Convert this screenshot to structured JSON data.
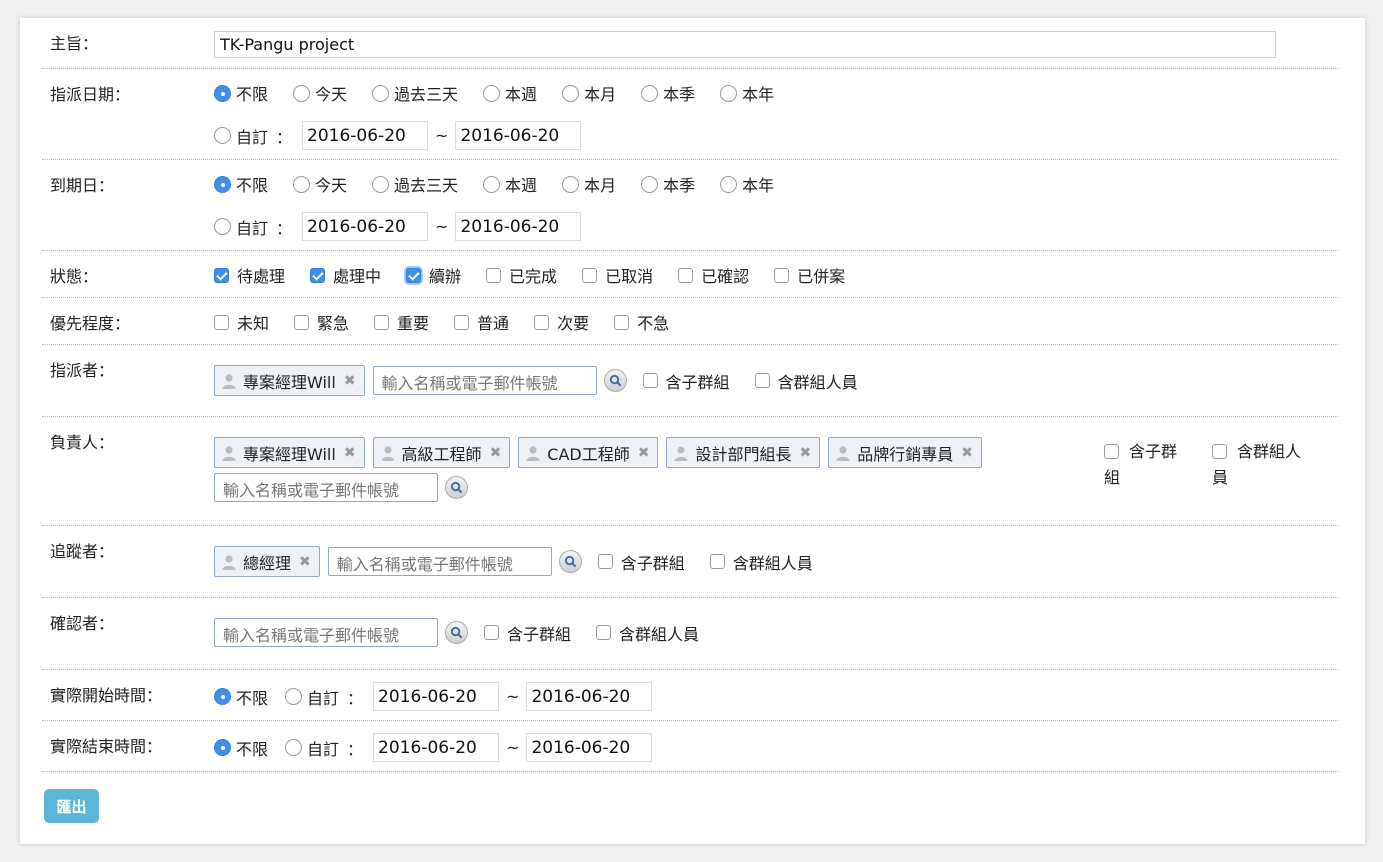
{
  "subject": {
    "label": "主旨：",
    "value": "TK-Pangu project"
  },
  "assign_date": {
    "label": "指派日期：",
    "options": [
      "不限",
      "今天",
      "過去三天",
      "本週",
      "本月",
      "本季",
      "本年"
    ],
    "custom_label": "自訂",
    "colon": "：",
    "tilde": "~",
    "from": "2016-06-20",
    "to": "2016-06-20"
  },
  "due_date": {
    "label": "到期日：",
    "options": [
      "不限",
      "今天",
      "過去三天",
      "本週",
      "本月",
      "本季",
      "本年"
    ],
    "custom_label": "自訂",
    "colon": "：",
    "tilde": "~",
    "from": "2016-06-20",
    "to": "2016-06-20"
  },
  "status": {
    "label": "狀態：",
    "options": [
      "待處理",
      "處理中",
      "續辦",
      "已完成",
      "已取消",
      "已確認",
      "已併案"
    ]
  },
  "priority": {
    "label": "優先程度：",
    "options": [
      "未知",
      "緊急",
      "重要",
      "普通",
      "次要",
      "不急"
    ]
  },
  "assigner": {
    "label": "指派者：",
    "tags": [
      "專案經理Will"
    ],
    "placeholder": "輸入名稱或電子郵件帳號",
    "sub_group": "含子群組",
    "group_members": "含群組人員"
  },
  "owner": {
    "label": "負責人：",
    "tags": [
      "專案經理Will",
      "高級工程師",
      "CAD工程師",
      "設計部門組長",
      "品牌行銷專員"
    ],
    "placeholder": "輸入名稱或電子郵件帳號",
    "sub_group_a": "含子群",
    "sub_group_b": "組",
    "group_members_a": "含群組人",
    "group_members_b": "員"
  },
  "follower": {
    "label": "追蹤者：",
    "tags": [
      "總經理"
    ],
    "placeholder": "輸入名稱或電子郵件帳號",
    "sub_group": "含子群組",
    "group_members": "含群組人員"
  },
  "confirmer": {
    "label": "確認者：",
    "placeholder": "輸入名稱或電子郵件帳號",
    "sub_group": "含子群組",
    "group_members": "含群組人員"
  },
  "actual_start": {
    "label": "實際開始時間：",
    "any": "不限",
    "custom_label": "自訂",
    "colon": "：",
    "tilde": "~",
    "from": "2016-06-20",
    "to": "2016-06-20"
  },
  "actual_end": {
    "label": "實際結束時間：",
    "any": "不限",
    "custom_label": "自訂",
    "colon": "：",
    "tilde": "~",
    "from": "2016-06-20",
    "to": "2016-06-20"
  },
  "export_label": "匯出",
  "colors": {
    "accent": "#3f8fe8",
    "export_button": "#5bb7d9",
    "tag_border": "#8fa9c4"
  }
}
